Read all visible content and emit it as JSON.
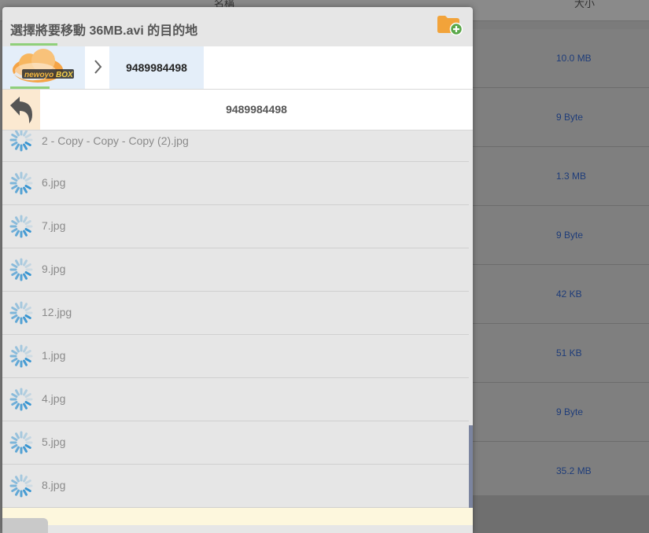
{
  "background": {
    "headers": {
      "name": "名稱",
      "size": "大小"
    },
    "sizes": [
      "10.0 MB",
      "9 Byte",
      "1.3 MB",
      "9 Byte",
      "42 KB",
      "51 KB",
      "9 Byte",
      "35.2 MB"
    ]
  },
  "dialog": {
    "title": "選擇將要移動 36MB.avi 的目的地",
    "new_folder_icon": "folder-add-icon",
    "breadcrumb": {
      "home_logo": "newoyo BOX",
      "current": "9489984498"
    },
    "path_title": "9489984498",
    "files": [
      {
        "name": "2 - Copy - Copy - Copy (2).jpg"
      },
      {
        "name": "6.jpg"
      },
      {
        "name": "7.jpg"
      },
      {
        "name": "9.jpg"
      },
      {
        "name": "12.jpg"
      },
      {
        "name": "1.jpg"
      },
      {
        "name": "4.jpg"
      },
      {
        "name": "5.jpg"
      },
      {
        "name": "8.jpg"
      }
    ]
  },
  "colors": {
    "accent_green": "#8fd07b",
    "folder_orange": "#f2a33a",
    "crumb_bg": "#e4eef9",
    "back_bg": "#fbe9d1",
    "spinner_blue": "#2b8fd0"
  }
}
